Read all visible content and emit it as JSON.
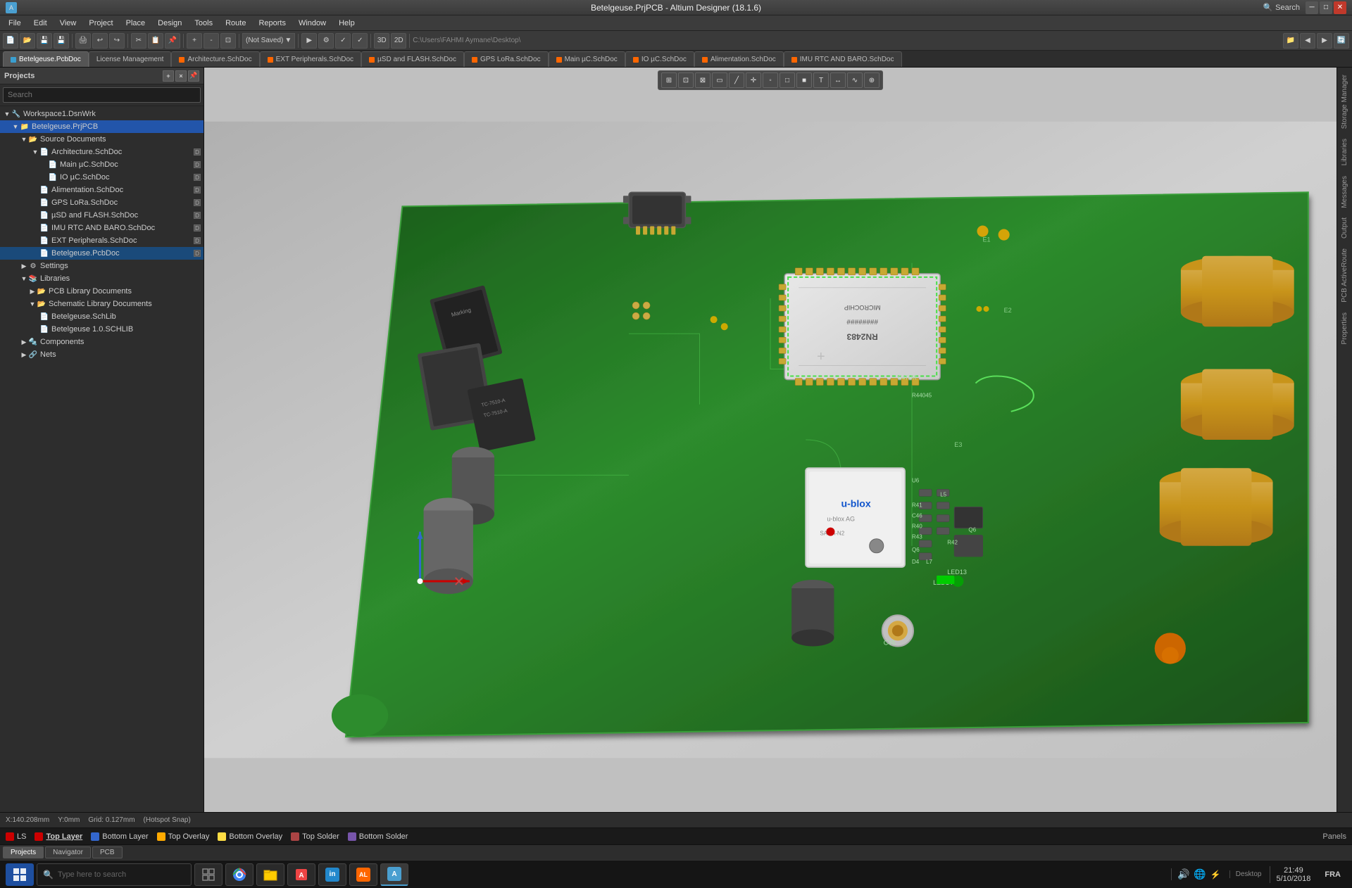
{
  "titlebar": {
    "title": "Betelgeuse.PrjPCB - Altium Designer (18.1.6)",
    "search_label": "Search",
    "minimize_label": "─",
    "maximize_label": "□",
    "close_label": "✕"
  },
  "menubar": {
    "items": [
      "File",
      "Edit",
      "View",
      "Project",
      "Place",
      "Design",
      "Tools",
      "Route",
      "Reports",
      "Window",
      "Help"
    ]
  },
  "toolbar": {
    "not_saved_label": "(Not Saved)",
    "path_label": "C:\\Users\\FAHMI Aymane\\Desktop\\"
  },
  "tabs": [
    {
      "label": "Betelgeuse.PcbDoc",
      "color": "#3a9fd0",
      "active": true
    },
    {
      "label": "License Management",
      "color": "#888"
    },
    {
      "label": "Architecture.SchDoc",
      "color": "#ff6600"
    },
    {
      "label": "EXT Peripherals.SchDoc",
      "color": "#ff6600"
    },
    {
      "label": "µSD and FLASH.SchDoc",
      "color": "#ff6600"
    },
    {
      "label": "GPS LoRa.SchDoc",
      "color": "#ff6600"
    },
    {
      "label": "Main µC.SchDoc",
      "color": "#ff6600"
    },
    {
      "label": "IO µC.SchDoc",
      "color": "#ff6600"
    },
    {
      "label": "Alimentation.SchDoc",
      "color": "#ff6600"
    },
    {
      "label": "IMU RTC AND BARO.SchDoc",
      "color": "#ff6600"
    }
  ],
  "panel": {
    "title": "Projects",
    "search_placeholder": "Search",
    "tree": [
      {
        "level": 0,
        "type": "workspace",
        "label": "Workspace1.DsnWrk",
        "icon": "🔧",
        "expanded": true
      },
      {
        "level": 1,
        "type": "project",
        "label": "Betelgeuse.PrjPCB",
        "icon": "📁",
        "expanded": true,
        "selected": false
      },
      {
        "level": 2,
        "type": "folder",
        "label": "Source Documents",
        "icon": "📂",
        "expanded": true
      },
      {
        "level": 3,
        "type": "folder",
        "label": "Architecture.SchDoc",
        "icon": "📄",
        "badge": "D"
      },
      {
        "level": 3,
        "type": "file",
        "label": "Main µC.SchDoc",
        "icon": "📄",
        "badge": "D"
      },
      {
        "level": 3,
        "type": "file",
        "label": "IO µC.SchDoc",
        "icon": "📄",
        "badge": "D"
      },
      {
        "level": 3,
        "type": "file",
        "label": "Alimentation.SchDoc",
        "icon": "📄",
        "badge": "D"
      },
      {
        "level": 3,
        "type": "file",
        "label": "GPS LoRa.SchDoc",
        "icon": "📄",
        "badge": "D"
      },
      {
        "level": 3,
        "type": "file",
        "label": "µSD and FLASH.SchDoc",
        "icon": "📄",
        "badge": "D"
      },
      {
        "level": 3,
        "type": "file",
        "label": "IMU RTC AND BARO.SchDoc",
        "icon": "📄",
        "badge": "D"
      },
      {
        "level": 3,
        "type": "file",
        "label": "EXT Peripherals.SchDoc",
        "icon": "📄",
        "badge": "D"
      },
      {
        "level": 3,
        "type": "file",
        "label": "Betelgeuse.PcbDoc",
        "icon": "📄",
        "badge": "D",
        "selected": true
      },
      {
        "level": 2,
        "type": "folder",
        "label": "Settings",
        "icon": "⚙️",
        "expanded": false
      },
      {
        "level": 2,
        "type": "folder",
        "label": "Libraries",
        "icon": "📚",
        "expanded": true
      },
      {
        "level": 3,
        "type": "folder",
        "label": "PCB Library Documents",
        "icon": "📂",
        "expanded": false
      },
      {
        "level": 3,
        "type": "folder",
        "label": "Schematic Library Documents",
        "icon": "📂",
        "expanded": true
      },
      {
        "level": 4,
        "type": "file",
        "label": "Betelgeuse.SchLib",
        "icon": "📄"
      },
      {
        "level": 4,
        "type": "file",
        "label": "Betelgeuse 1.0.SCHLIB",
        "icon": "📄"
      },
      {
        "level": 2,
        "type": "folder",
        "label": "Components",
        "icon": "🔩",
        "expanded": false
      },
      {
        "level": 2,
        "type": "folder",
        "label": "Nets",
        "icon": "🔗",
        "expanded": false
      }
    ]
  },
  "right_side": {
    "tabs": [
      "Storage Manager",
      "Libraries",
      "Messages",
      "Output",
      "PCB ActiveRoute",
      "Properties"
    ]
  },
  "pcb_toolbar": {
    "tools": [
      "filter",
      "select",
      "select2",
      "rect",
      "line",
      "cross",
      "point",
      "box1",
      "box2",
      "text",
      "pan"
    ]
  },
  "coord_bar": {
    "x_label": "X:140.208mm",
    "y_label": "Y:0mm",
    "grid_label": "Grid: 0.127mm",
    "snap_label": "(Hotspot Snap)"
  },
  "layer_bar": {
    "layers": [
      {
        "color": "#cc0000",
        "label": "LS",
        "active": false
      },
      {
        "color": "#cc0000",
        "label": "Top Layer",
        "active": true
      },
      {
        "color": "#3366cc",
        "label": "Bottom Layer",
        "active": false
      },
      {
        "color": "#ffaa00",
        "label": "Top Overlay",
        "active": false
      },
      {
        "color": "#ffdd00",
        "label": "Bottom Overlay",
        "active": false
      },
      {
        "color": "#aa4444",
        "label": "Top Solder",
        "active": false
      },
      {
        "color": "#7755aa",
        "label": "Bottom Solder",
        "active": false
      }
    ]
  },
  "bottom_tabs": {
    "tabs": [
      "Projects",
      "Navigator",
      "PCB"
    ]
  },
  "taskbar": {
    "search_placeholder": "Type here to search",
    "time": "21:49",
    "date": "5/10/2018",
    "lang": "FRA",
    "desktop_label": "Desktop",
    "panels_label": "Panels",
    "apps": [
      "windows",
      "search",
      "task-view",
      "chrome",
      "explorer",
      "acrobat",
      "app5",
      "app6",
      "altium"
    ]
  }
}
